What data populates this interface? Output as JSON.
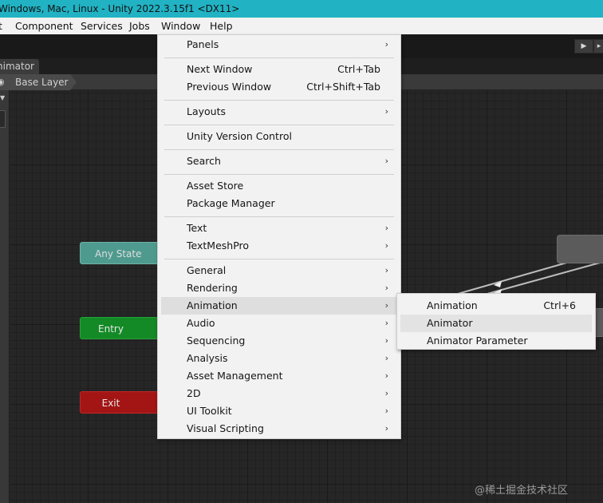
{
  "window": {
    "title": "Windows, Mac, Linux - Unity 2022.3.15f1 <DX11>"
  },
  "menubar": {
    "items": [
      {
        "label": "t"
      },
      {
        "label": "Component"
      },
      {
        "label": "Services"
      },
      {
        "label": "Jobs"
      },
      {
        "label": "Window"
      },
      {
        "label": "Help"
      }
    ]
  },
  "toolbar": {
    "play_icon": "play-icon",
    "overflow_icon": "more-icon"
  },
  "tab": {
    "label": "nimator"
  },
  "breadcrumb": {
    "icon": "eye-icon",
    "label": "Base Layer"
  },
  "graph": {
    "nodes": {
      "any_state": "Any State",
      "entry": "Entry",
      "exit": "Exit"
    },
    "colors": {
      "any_state": "#4f9a8e",
      "entry": "#138a26",
      "exit": "#a31515",
      "state": "#5b5b5b"
    }
  },
  "window_menu": {
    "items": [
      {
        "label": "Panels",
        "shortcut": "",
        "submenu": true
      },
      {
        "label": "Next Window",
        "shortcut": "Ctrl+Tab",
        "submenu": false
      },
      {
        "label": "Previous Window",
        "shortcut": "Ctrl+Shift+Tab",
        "submenu": false
      },
      {
        "label": "Layouts",
        "shortcut": "",
        "submenu": true
      },
      {
        "label": "Unity Version Control",
        "shortcut": "",
        "submenu": false
      },
      {
        "label": "Search",
        "shortcut": "",
        "submenu": true
      },
      {
        "label": "Asset Store",
        "shortcut": "",
        "submenu": false
      },
      {
        "label": "Package Manager",
        "shortcut": "",
        "submenu": false
      },
      {
        "label": "Text",
        "shortcut": "",
        "submenu": true
      },
      {
        "label": "TextMeshPro",
        "shortcut": "",
        "submenu": true
      },
      {
        "label": "General",
        "shortcut": "",
        "submenu": true
      },
      {
        "label": "Rendering",
        "shortcut": "",
        "submenu": true
      },
      {
        "label": "Animation",
        "shortcut": "",
        "submenu": true,
        "highlighted": true
      },
      {
        "label": "Audio",
        "shortcut": "",
        "submenu": true
      },
      {
        "label": "Sequencing",
        "shortcut": "",
        "submenu": true
      },
      {
        "label": "Analysis",
        "shortcut": "",
        "submenu": true
      },
      {
        "label": "Asset Management",
        "shortcut": "",
        "submenu": true
      },
      {
        "label": "2D",
        "shortcut": "",
        "submenu": true
      },
      {
        "label": "UI Toolkit",
        "shortcut": "",
        "submenu": true
      },
      {
        "label": "Visual Scripting",
        "shortcut": "",
        "submenu": true
      }
    ],
    "submenu_arrow": "›"
  },
  "animation_submenu": {
    "items": [
      {
        "label": "Animation",
        "shortcut": "Ctrl+6"
      },
      {
        "label": "Animator",
        "shortcut": "",
        "highlighted": true
      },
      {
        "label": "Animator Parameter",
        "shortcut": ""
      }
    ]
  },
  "watermark": {
    "text": "@稀土掘金技术社区"
  }
}
